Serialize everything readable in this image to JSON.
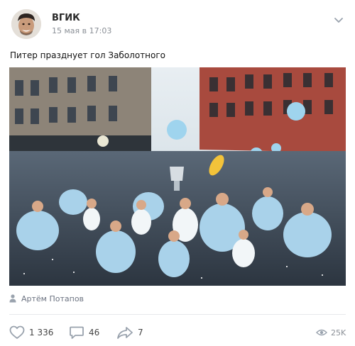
{
  "post": {
    "author": "ВГИК",
    "date": "15 мая в 17:03",
    "text": "Питер празднует гол Заболотного",
    "signature": "Артём Потапов"
  },
  "actions": {
    "likes": "1 336",
    "comments": "46",
    "shares": "7",
    "views": "25K"
  },
  "icons": {
    "more": "more-icon",
    "signer": "person-icon",
    "like": "heart-icon",
    "comment": "comment-icon",
    "share": "share-icon",
    "views": "eye-icon"
  },
  "colors": {
    "meta_text": "#8a8f96",
    "icon": "#99a2ad",
    "divider": "#e7e8ec"
  }
}
